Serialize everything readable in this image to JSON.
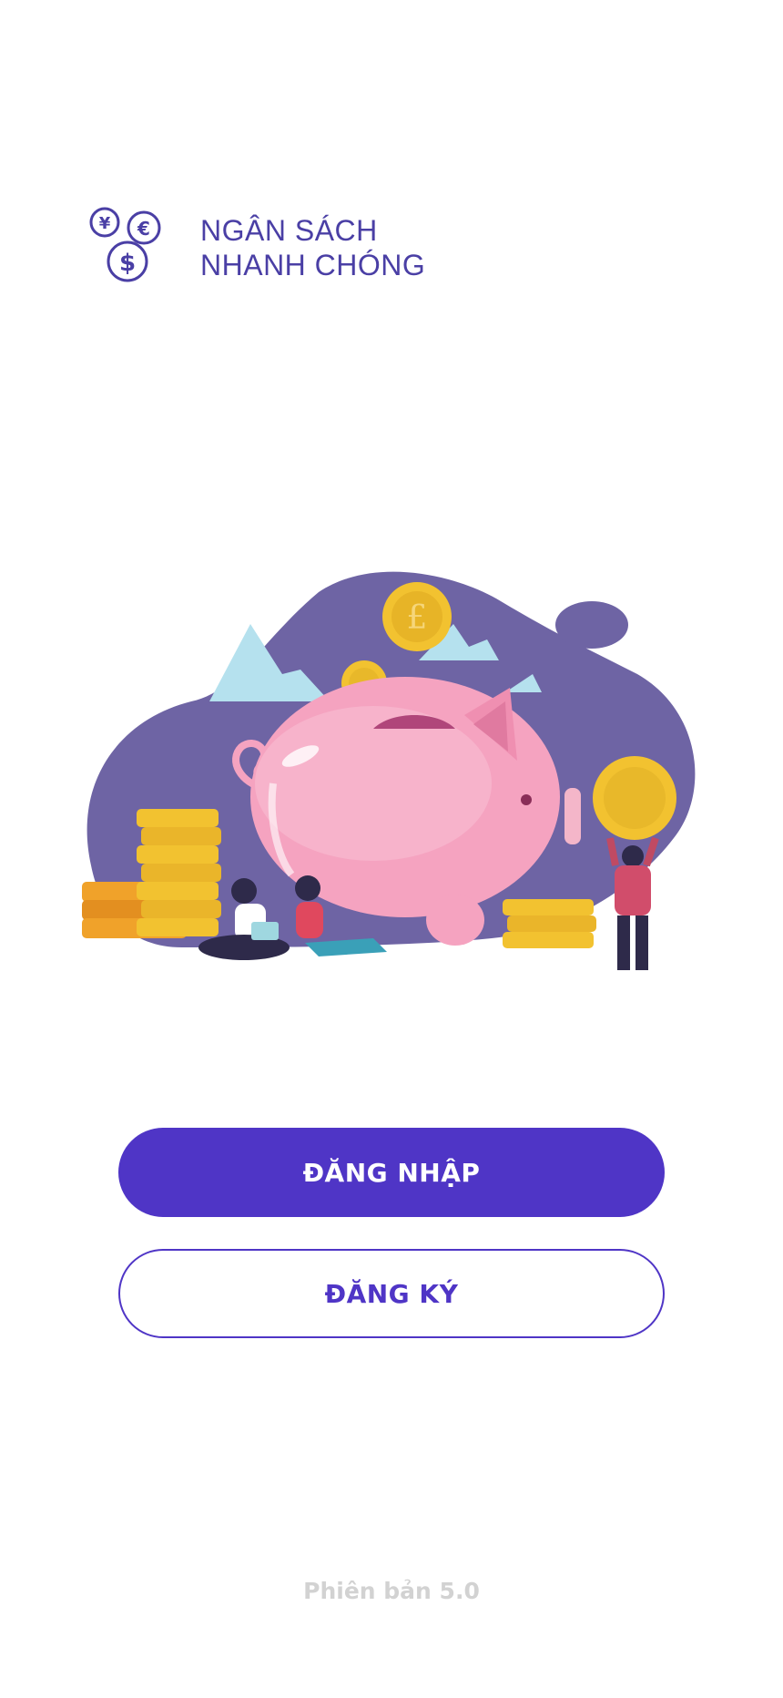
{
  "brand": {
    "line1": "NGÂN SÁCH",
    "line2": "NHANH CHÓNG",
    "logo_icon": "currency-coins-icon",
    "logo_symbols": [
      "¥",
      "€",
      "$"
    ]
  },
  "illustration": {
    "icon": "piggy-bank-savings-illustration"
  },
  "actions": {
    "login_label": "ĐĂNG NHẬP",
    "register_label": "ĐĂNG KÝ"
  },
  "footer": {
    "version": "Phiên bản 5.0"
  },
  "colors": {
    "brand": "#4a3fa5",
    "primary": "#4f35c6",
    "blob": "#6e64a4",
    "pig": "#f5a3c0",
    "coin": "#f2c230",
    "version_text": "#d2d2d2"
  }
}
